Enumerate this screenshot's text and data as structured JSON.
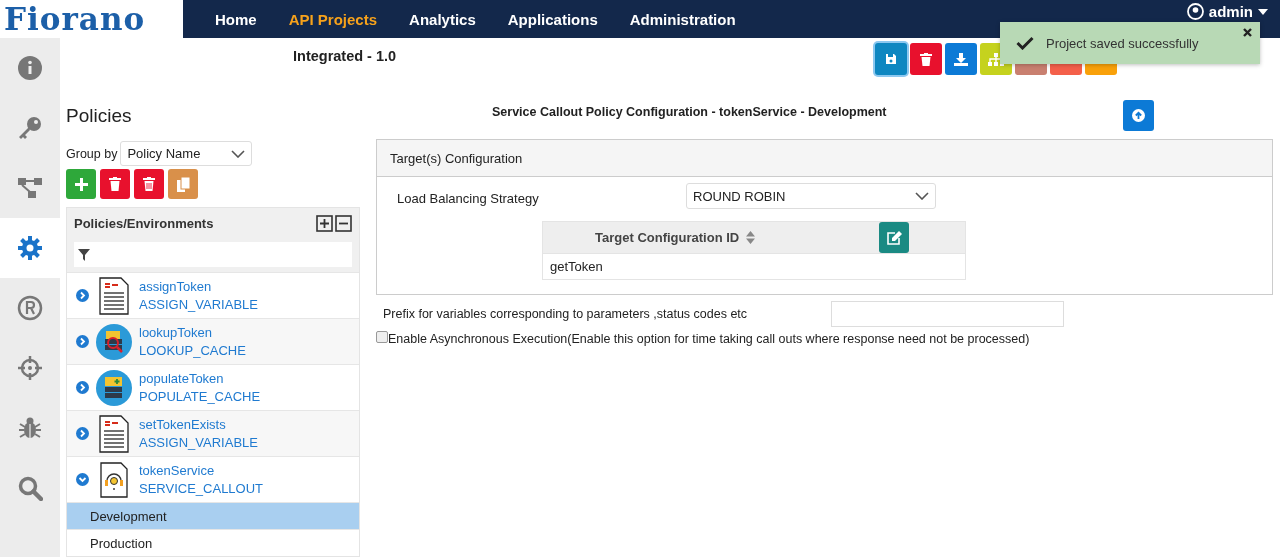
{
  "header": {
    "logo": "Fiorano",
    "nav": [
      {
        "label": "Home",
        "selected": false
      },
      {
        "label": "API Projects",
        "selected": true
      },
      {
        "label": "Analytics",
        "selected": false
      },
      {
        "label": "Applications",
        "selected": false
      },
      {
        "label": "Administration",
        "selected": false
      }
    ],
    "user": "admin"
  },
  "sidebar": {
    "items": [
      {
        "selected": false
      },
      {
        "selected": false
      },
      {
        "selected": false
      },
      {
        "selected": true
      },
      {
        "selected": false
      },
      {
        "selected": false
      },
      {
        "selected": false
      },
      {
        "selected": false
      }
    ]
  },
  "project_title": "Integrated - 1.0",
  "toolbar": [
    {
      "kind": "save",
      "color": "#0e87c1",
      "focused": true
    },
    {
      "kind": "delete",
      "color": "#e8112d",
      "focused": false
    },
    {
      "kind": "download",
      "color": "#0c7ad6",
      "focused": false
    },
    {
      "kind": "hierarchy",
      "color": "#c5d21e",
      "focused": false
    },
    {
      "kind": "blank",
      "color": "#c98070",
      "focused": false
    },
    {
      "kind": "blank",
      "color": "#f4604a",
      "focused": false
    },
    {
      "kind": "blank",
      "color": "#f9a10a",
      "focused": false
    }
  ],
  "toast": {
    "message": "Project saved successfully"
  },
  "policies": {
    "title": "Policies",
    "group_by": {
      "label": "Group by",
      "value": "Policy Name"
    },
    "actions": [
      {
        "kind": "add"
      },
      {
        "kind": "delete"
      },
      {
        "kind": "delete_all"
      },
      {
        "kind": "copy"
      }
    ],
    "tree": {
      "title": "Policies/Environments",
      "items": [
        {
          "name": "assignToken",
          "type": "ASSIGN_VARIABLE",
          "kind": "variable",
          "expanded": false
        },
        {
          "name": "lookupToken",
          "type": "LOOKUP_CACHE",
          "kind": "lookup",
          "expanded": false
        },
        {
          "name": "populateToken",
          "type": "POPULATE_CACHE",
          "kind": "populate",
          "expanded": false
        },
        {
          "name": "setTokenExists",
          "type": "ASSIGN_VARIABLE",
          "kind": "variable",
          "expanded": false
        },
        {
          "name": "tokenService",
          "type": "SERVICE_CALLOUT",
          "kind": "callout",
          "expanded": true,
          "children": [
            {
              "label": "Development",
              "selected": true
            },
            {
              "label": "Production",
              "selected": false
            }
          ]
        }
      ]
    }
  },
  "config": {
    "title": "Service Callout Policy Configuration - tokenService - Development",
    "panel": {
      "title": "Target(s) Configuration",
      "strategy_label": "Load Balancing Strategy",
      "strategy": "ROUND ROBIN",
      "table": {
        "columns": [
          "Target Configuration ID"
        ],
        "rows": [
          [
            "getToken"
          ]
        ]
      }
    },
    "prefix_label": "Prefix for variables corresponding to parameters ,status codes etc",
    "async": {
      "label": "Enable Asynchronous Execution(Enable this option for time taking call outs where response need not be processed)",
      "checked": false
    }
  }
}
